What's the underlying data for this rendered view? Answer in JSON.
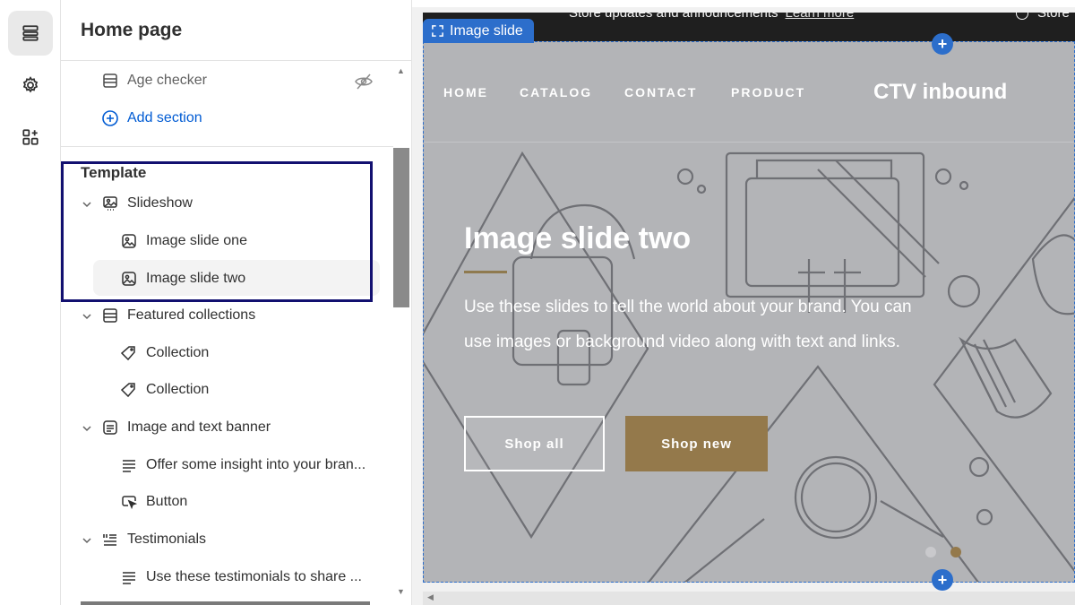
{
  "sidebar": {
    "title": "Home page",
    "age_checker": "Age checker",
    "add_section": "Add section",
    "template_label": "Template",
    "items": [
      {
        "label": "Slideshow",
        "icon": "slideshow-icon"
      },
      {
        "label": "Image slide one",
        "icon": "image-icon"
      },
      {
        "label": "Image slide two",
        "icon": "image-icon"
      },
      {
        "label": "Featured collections",
        "icon": "collection-list-icon"
      },
      {
        "label": "Collection",
        "icon": "tag-icon"
      },
      {
        "label": "Collection",
        "icon": "tag-icon"
      },
      {
        "label": "Image and text banner",
        "icon": "text-block-icon"
      },
      {
        "label": "Offer some insight into your bran...",
        "icon": "text-lines-icon"
      },
      {
        "label": "Button",
        "icon": "button-cursor-icon"
      },
      {
        "label": "Testimonials",
        "icon": "testimonials-icon"
      },
      {
        "label": "Use these testimonials to share ...",
        "icon": "text-lines-icon"
      }
    ]
  },
  "preview": {
    "announcement": "Store updates and announcements",
    "announcement_link": "Learn more",
    "announcement_right": "Store",
    "selected_tag": "Image slide",
    "nav": [
      "HOME",
      "CATALOG",
      "CONTACT",
      "PRODUCT"
    ],
    "brand": "CTV inbound",
    "hero_title": "Image slide two",
    "hero_text": "Use these slides to tell the world about your brand. You can use images or background video along with text and links.",
    "btn_shop_all": "Shop all",
    "btn_shop_new": "Shop new",
    "slide_count": 2,
    "active_slide": 2
  },
  "colors": {
    "accent_blue": "#2c6ecb",
    "highlight_box": "#121070",
    "button_gold": "#94794b",
    "stage_gray": "#b3b4b7"
  }
}
